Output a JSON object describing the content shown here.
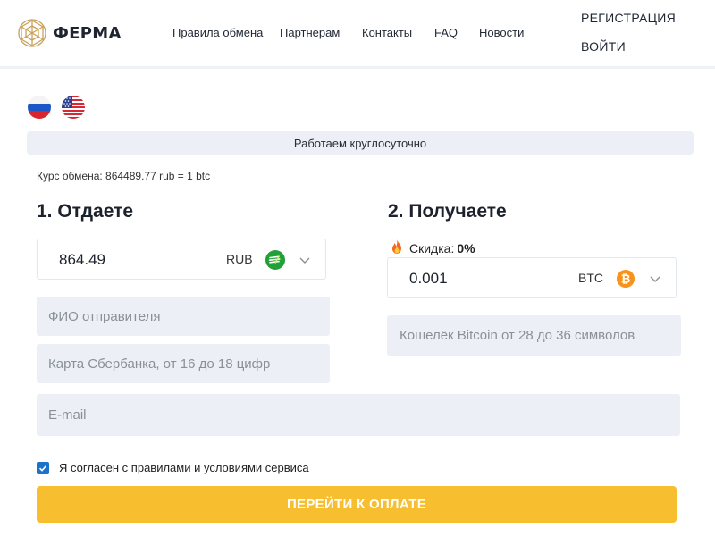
{
  "header": {
    "logo_text": "ФЕРМА",
    "nav": [
      "Правила обмена",
      "Партнерам",
      "Контакты",
      "FAQ",
      "Новости"
    ],
    "register": "РЕГИСТРАЦИЯ",
    "login": "ВОЙТИ"
  },
  "languages": [
    "russian-flag-icon",
    "us-flag-icon"
  ],
  "banner": "Работаем круглосуточно",
  "rate": "Курс обмена: 864489.77 rub = 1 btc",
  "give": {
    "title": "1. Отдаете",
    "amount": "864.49",
    "currency": "RUB",
    "currency_icon": "sberbank-icon",
    "sender_name_placeholder": "ФИО отправителя",
    "card_placeholder": "Карта Сбербанка, от 16 до 18 цифр"
  },
  "receive": {
    "title": "2. Получаете",
    "discount_label": "Скидка:",
    "discount_value": "0%",
    "discount_icon": "fire-icon",
    "amount": "0.001",
    "currency": "BTC",
    "currency_icon": "bitcoin-icon",
    "wallet_placeholder": "Кошелёк Bitcoin от 28 до 36 символов"
  },
  "email_placeholder": "E-mail",
  "agreement": {
    "prefix": "Я согласен с",
    "link": "правилами и условиями сервиса"
  },
  "submit_label": "ПЕРЕЙТИ К ОПЛАТЕ",
  "colors": {
    "accent_button": "#f7bf2f",
    "checkbox": "#1a73c8",
    "field_bg": "#eceff5",
    "bitcoin": "#f7931a",
    "sberbank": "#21a038"
  }
}
